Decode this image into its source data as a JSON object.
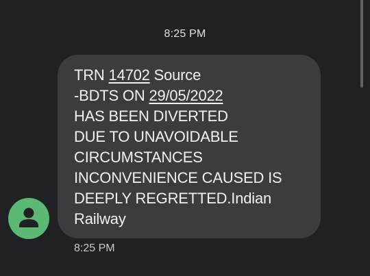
{
  "conversation": {
    "header_time": "8:25 PM",
    "message": {
      "sender_avatar_icon": "person-icon",
      "sender_avatar_color": "#5bb974",
      "bubble_color": "#3c3c3e",
      "line1": {
        "prefix": "TRN ",
        "train_number": "14702",
        "suffix": " Source"
      },
      "line2": {
        "prefix": "-BDTS ON ",
        "date": "29/05/2022"
      },
      "line3": "HAS BEEN DIVERTED",
      "line4": "DUE TO UNAVOIDABLE",
      "line5": "CIRCUMSTANCES",
      "line6": "INCONVENIENCE CAUSED IS",
      "line7": "DEEPLY REGRETTED.Indian",
      "line8": "Railway"
    },
    "footer_time": "8:25 PM"
  },
  "colors": {
    "background": "#202124",
    "text": "#f1f1f1"
  }
}
